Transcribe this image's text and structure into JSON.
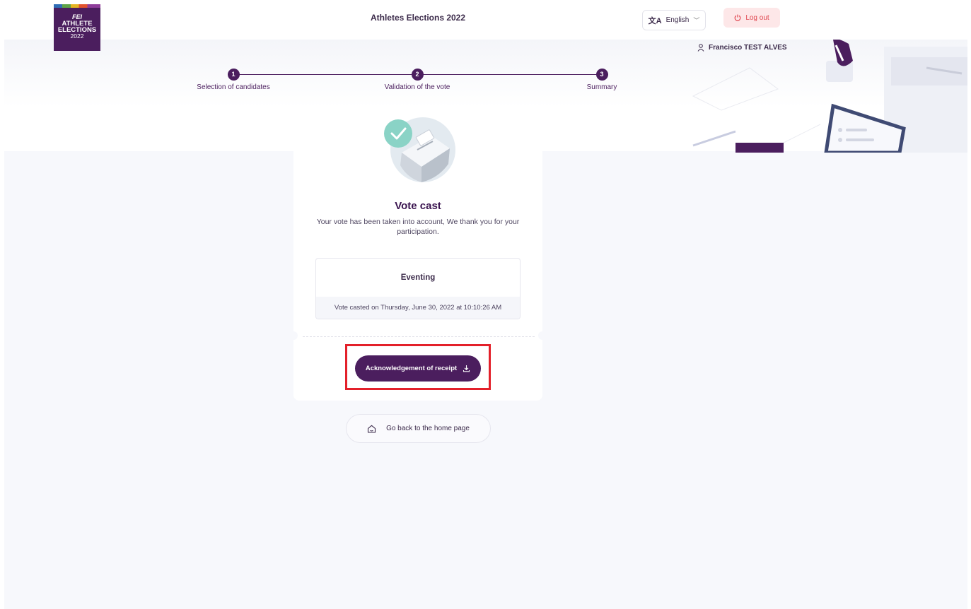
{
  "header": {
    "logo": {
      "line1": "FEI",
      "line2": "ATHLETE",
      "line3": "ELECTIONS",
      "line4": "2022"
    },
    "title": "Athletes Elections 2022",
    "language": {
      "icon": "translate-icon",
      "label": "English"
    },
    "logout": {
      "icon": "power-icon",
      "label": "Log out"
    },
    "user": {
      "icon": "user-icon",
      "name": "Francisco TEST ALVES"
    }
  },
  "stepper": {
    "steps": [
      {
        "number": "1",
        "label": "Selection of candidates"
      },
      {
        "number": "2",
        "label": "Validation of the vote"
      },
      {
        "number": "3",
        "label": "Summary"
      }
    ]
  },
  "confirmation": {
    "title": "Vote cast",
    "message": "Your vote has been taken into account, We thank you for your participation.",
    "ballot": {
      "category": "Eventing",
      "timestamp": "Vote casted on Thursday, June 30, 2022 at 10:10:26 AM"
    },
    "receipt_button": {
      "label": "Acknowledgement of receipt",
      "icon": "download-icon"
    },
    "home_button": {
      "label": "Go back to the home page",
      "icon": "home-icon"
    }
  },
  "colors": {
    "brand": "#4b1e5e",
    "success": "#8ad3c6",
    "logout_bg": "#fde7e8",
    "logout_text": "#e0464f",
    "highlight": "#e3202a"
  }
}
